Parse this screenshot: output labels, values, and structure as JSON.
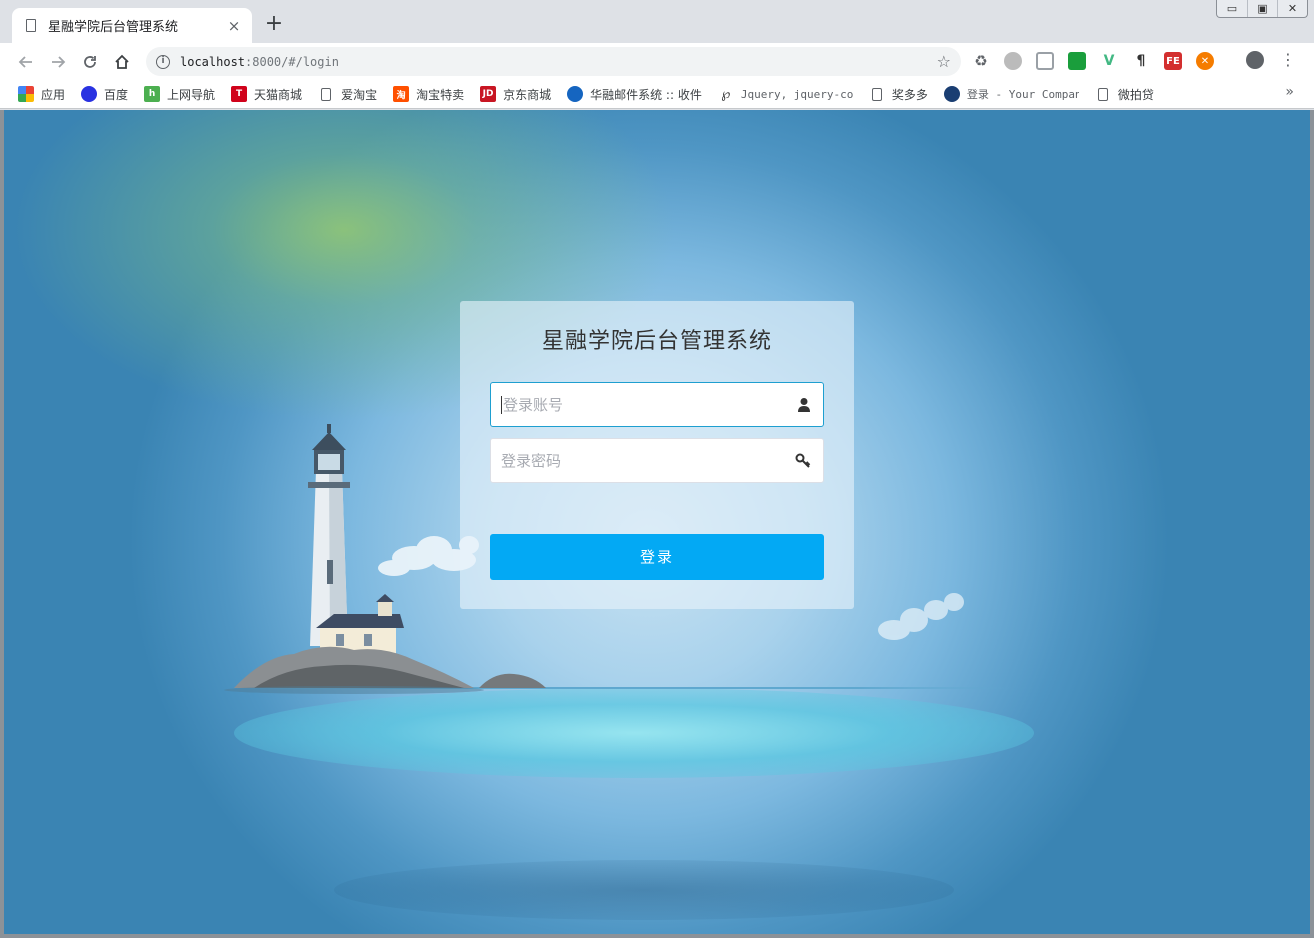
{
  "browser": {
    "tab_title": "星融学院后台管理系统",
    "tab_close": "×",
    "new_tab": "+",
    "url_host": "localhost",
    "url_rest": ":8000/#/login",
    "window_controls": [
      "▭",
      "▣",
      "✕"
    ]
  },
  "bookmarks": [
    {
      "label": "应用",
      "icon": "apps-grid-icon",
      "color": "#e94235"
    },
    {
      "label": "百度",
      "icon": "baidu-paw-icon",
      "color": "#2932e1"
    },
    {
      "label": "上网导航",
      "icon": "hao123-icon",
      "color": "#4caf50"
    },
    {
      "label": "天猫商城",
      "icon": "tmall-icon",
      "color": "#d0021b"
    },
    {
      "label": "爱淘宝",
      "icon": "doc-icon",
      "color": ""
    },
    {
      "label": "淘宝特卖",
      "icon": "taobao-icon",
      "color": "#ff5000"
    },
    {
      "label": "京东商城",
      "icon": "jd-icon",
      "color": "#c81623"
    },
    {
      "label": "华融邮件系统 :: 收件",
      "icon": "mail-icon",
      "color": "#1565c0"
    },
    {
      "label": "Jquery, jquery-cook:",
      "icon": "script-icon",
      "color": ""
    },
    {
      "label": "奖多多",
      "icon": "doc-icon",
      "color": ""
    },
    {
      "label": "登录 - Your Company",
      "icon": "company-icon",
      "color": "#1a3e72"
    },
    {
      "label": "微拍贷",
      "icon": "doc-icon",
      "color": ""
    }
  ],
  "bookmarks_more": "»",
  "login": {
    "title": "星融学院后台管理系统",
    "username_placeholder": "登录账号",
    "password_placeholder": "登录密码",
    "submit_label": "登录"
  },
  "colors": {
    "accent": "#03a9f4",
    "focus_border": "#1e9fd0"
  }
}
